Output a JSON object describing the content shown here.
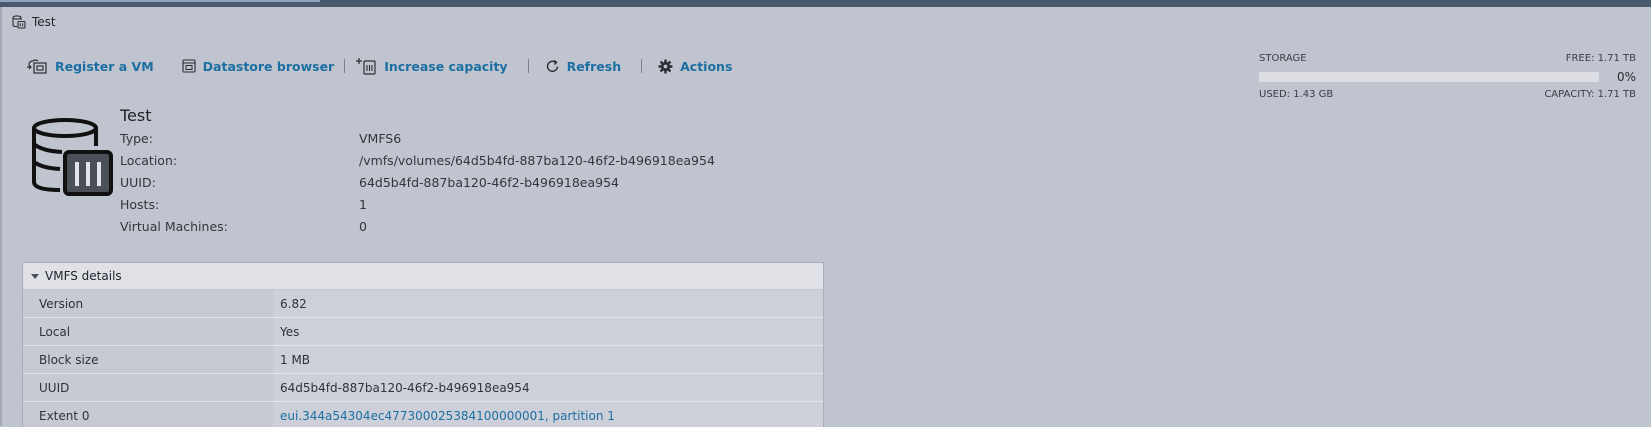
{
  "window": {
    "title": "Test",
    "icon": "datastore-icon"
  },
  "toolbar": {
    "register_vm": "Register a VM",
    "datastore_browser": "Datastore browser",
    "increase_capacity": "Increase capacity",
    "refresh": "Refresh",
    "actions": "Actions"
  },
  "storage": {
    "label": "STORAGE",
    "free": "FREE: 1.71 TB",
    "percent_text": "0%",
    "used_fraction": 0.0,
    "used": "USED: 1.43 GB",
    "capacity": "CAPACITY: 1.71 TB",
    "bar_color": "#2e8fc7"
  },
  "summary": {
    "name": "Test",
    "fields": [
      {
        "label": "Type:",
        "value": "VMFS6"
      },
      {
        "label": "Location:",
        "value": "/vmfs/volumes/64d5b4fd-887ba120-46f2-b496918ea954"
      },
      {
        "label": "UUID:",
        "value": "64d5b4fd-887ba120-46f2-b496918ea954"
      },
      {
        "label": "Hosts:",
        "value": "1"
      },
      {
        "label": "Virtual Machines:",
        "value": "0"
      }
    ]
  },
  "vmfs_details": {
    "title": "VMFS details",
    "rows": [
      {
        "label": "Version",
        "value": "6.82"
      },
      {
        "label": "Local",
        "value": "Yes"
      },
      {
        "label": "Block size",
        "value": "1 MB"
      },
      {
        "label": "UUID",
        "value": "64d5b4fd-887ba120-46f2-b496918ea954"
      },
      {
        "label": "Extent 0",
        "value": "eui.344a54304ec477300025384100000001, partition 1"
      }
    ]
  }
}
